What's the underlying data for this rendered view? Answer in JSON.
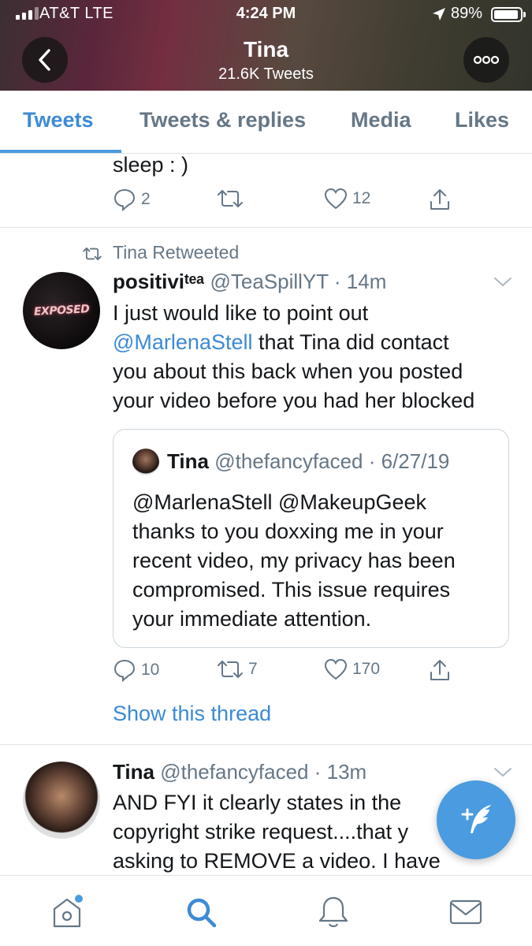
{
  "status_bar": {
    "carrier": "AT&T  LTE",
    "time": "4:24 PM",
    "battery": "89%"
  },
  "header": {
    "name": "Tina",
    "tweet_count": "21.6K Tweets"
  },
  "tabs": [
    {
      "label": "Tweets",
      "active": true
    },
    {
      "label": "Tweets & replies",
      "active": false
    },
    {
      "label": "Media",
      "active": false
    },
    {
      "label": "Likes",
      "active": false
    }
  ],
  "tweet1": {
    "text_tail": "sleep : )",
    "replies": "2",
    "retweets": "",
    "likes": "12"
  },
  "tweet2": {
    "retweet_label": "Tina Retweeted",
    "name": "positiviᵗᵉᵃ",
    "handle": "@TeaSpillYT",
    "time": "14m",
    "avatar_text": "EXPOSED",
    "text_line1": "I just would like to point out",
    "mention": "@MarlenaStell",
    "text_line2_rest": " that Tina did contact",
    "text_line3": "you about this back when you posted",
    "text_line4": "your video before you had her blocked",
    "quote": {
      "name": "Tina",
      "handle": "@thefancyfaced",
      "date": "6/27/19",
      "mention1": "@MarlenaStell",
      "mention2": "@MakeupGeek",
      "line2": "thanks to you doxxing me in your",
      "line3": "recent video, my privacy has been",
      "line4": "compromised. This issue requires",
      "line5": "your immediate attention."
    },
    "replies": "10",
    "retweets": "7",
    "likes": "170",
    "show_thread": "Show this thread"
  },
  "tweet3": {
    "name": "Tina",
    "handle": "@thefancyfaced",
    "time": "13m",
    "line1": "AND FYI it clearly states in the",
    "line2": "copyright strike request....that y",
    "line3": "asking to REMOVE a video. I have"
  },
  "colors": {
    "accent": "#4a9be0",
    "muted": "#657786",
    "link": "#3b8ad5"
  },
  "icons": [
    "back-icon",
    "more-icon",
    "reply-icon",
    "retweet-icon",
    "like-icon",
    "share-icon",
    "chevron-down-icon",
    "compose-icon",
    "home-icon",
    "search-icon",
    "bell-icon",
    "mail-icon"
  ]
}
